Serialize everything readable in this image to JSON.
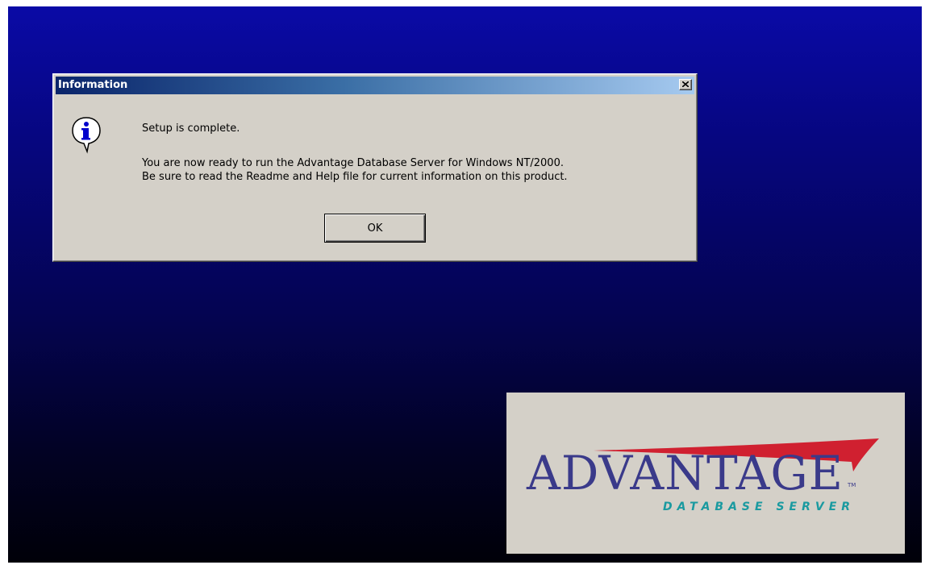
{
  "dialog": {
    "title": "Information",
    "message_line1": "Setup is complete.",
    "message_line2": "You are now ready to run the Advantage Database Server for Windows NT/2000.",
    "message_line3": "Be sure to read the Readme and Help file for current information on this product.",
    "ok_label": "OK",
    "icon": "info-icon"
  },
  "logo": {
    "word": "ADVANTAGE",
    "tm": "TM",
    "subtitle": "DATABASE SERVER",
    "colors": {
      "word": "#3a3a8a",
      "subtitle": "#1a9aa0",
      "swoosh": "#d02030"
    }
  },
  "colors": {
    "desktop_top": "#0a0aa6",
    "desktop_bottom": "#000008",
    "title_active": "#0a246a",
    "face": "#d4d0c8"
  }
}
